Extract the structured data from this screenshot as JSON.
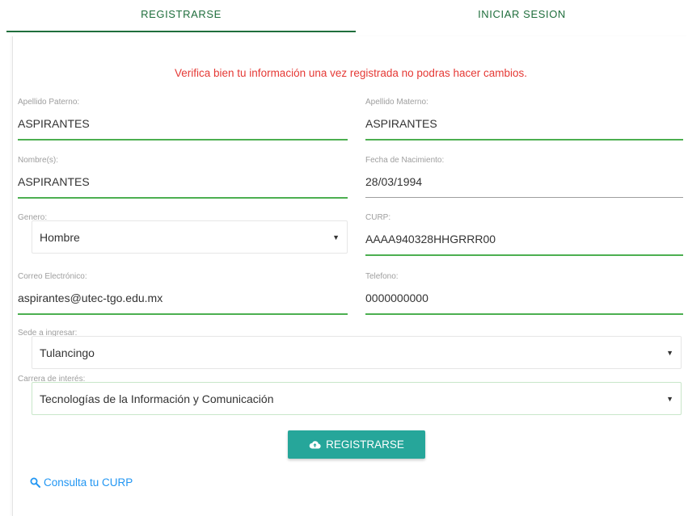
{
  "tabs": {
    "register": "REGISTRARSE",
    "login": "INICIAR SESION"
  },
  "warning": "Verifica bien tu información una vez registrada no podras hacer cambios.",
  "fields": {
    "apellido_paterno": {
      "label": "Apellido Paterno:",
      "value": "ASPIRANTES"
    },
    "apellido_materno": {
      "label": "Apellido Materno:",
      "value": "ASPIRANTES"
    },
    "nombre": {
      "label": "Nombre(s):",
      "value": "ASPIRANTES"
    },
    "fecha_nacimiento": {
      "label": "Fecha de Nacimiento:",
      "value": "28/03/1994"
    },
    "genero": {
      "label": "Genero:",
      "value": "Hombre"
    },
    "curp": {
      "label": "CURP:",
      "value": "AAAA940328HHGRRR00"
    },
    "correo": {
      "label": "Correo Electrónico:",
      "value": "aspirantes@utec-tgo.edu.mx"
    },
    "telefono": {
      "label": "Telefono:",
      "value": "0000000000"
    },
    "sede": {
      "label": "Sede a ingresar:",
      "value": "Tulancingo"
    },
    "carrera": {
      "label": "Carrera de interés:",
      "value": "Tecnologías de la Información y Comunicación"
    }
  },
  "submit_label": "REGISTRARSE",
  "curp_link": "Consulta tu CURP",
  "icons": {
    "submit": "cloud-upload-icon",
    "link": "search-icon"
  },
  "colors": {
    "primary_green": "#1f6e3c",
    "field_underline": "#4caf50",
    "warning": "#e53935",
    "button": "#26a69a",
    "link": "#2196f3"
  }
}
